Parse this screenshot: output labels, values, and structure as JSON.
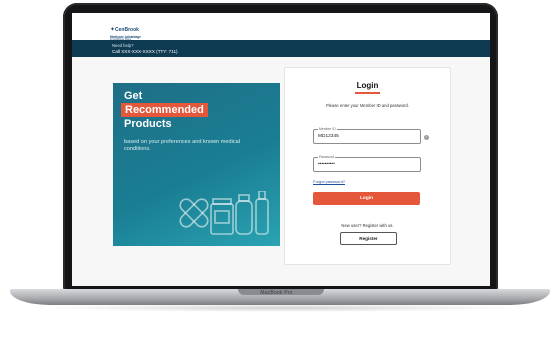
{
  "header": {
    "logo_name": "CenBrook",
    "logo_line1": "Medicare Advantage",
    "logo_line2": "& CenBrook Plans"
  },
  "helpbar": {
    "line1": "Need help?",
    "line2": "Call XXX-XXX-XXXX (TTY: 711)"
  },
  "promo": {
    "line1": "Get",
    "line2": "Recommended",
    "line3": "Products",
    "description": "based on your preferences and known medical conditions.",
    "accent_color": "#e5573b"
  },
  "login": {
    "title": "Login",
    "instruction": "Please enter your Member ID and password.",
    "member_id_label": "Member ID",
    "member_id_value": "MD12345",
    "password_label": "Password",
    "password_value": "••••••••••",
    "forgot_link": "Forgot password?",
    "login_button": "Login",
    "new_user_text": "New user? Register with us.",
    "register_button": "Register",
    "info_icon": "i"
  },
  "device": {
    "label": "MacBook Pro"
  },
  "icons": [
    "info-icon",
    "bandage-icon",
    "medicine-box-icon",
    "pill-bottle-icon",
    "spray-bottle-icon"
  ]
}
